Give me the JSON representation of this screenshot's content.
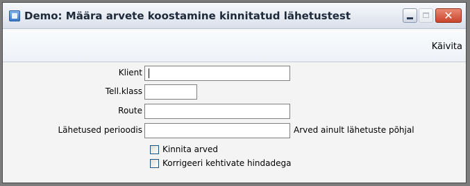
{
  "window": {
    "title": "Demo: Määra arvete koostamine kinnitatud lähetustest",
    "close_glyph": "✕"
  },
  "toolbar": {
    "run_label": "Käivita"
  },
  "form": {
    "client_label": "Klient",
    "client_value": "",
    "order_class_label": "Tell.klass",
    "order_class_value": "",
    "route_label": "Route",
    "route_value": "",
    "period_label": "Lähetused perioodis",
    "period_value": "",
    "period_hint": "Arved ainult lähetuste põhjal",
    "confirm_invoices_label": "Kinnita arved",
    "confirm_invoices_checked": false,
    "correct_prices_label": "Korrigeeri kehtivate hindadega",
    "correct_prices_checked": false
  },
  "colors": {
    "title_text": "#1e2a3a",
    "close_button": "#c8442a",
    "window_background": "#f4f4f4"
  },
  "icons": {
    "app": "window-app-icon",
    "minimize": "minimize-icon",
    "maximize": "maximize-icon",
    "close": "close-icon"
  }
}
